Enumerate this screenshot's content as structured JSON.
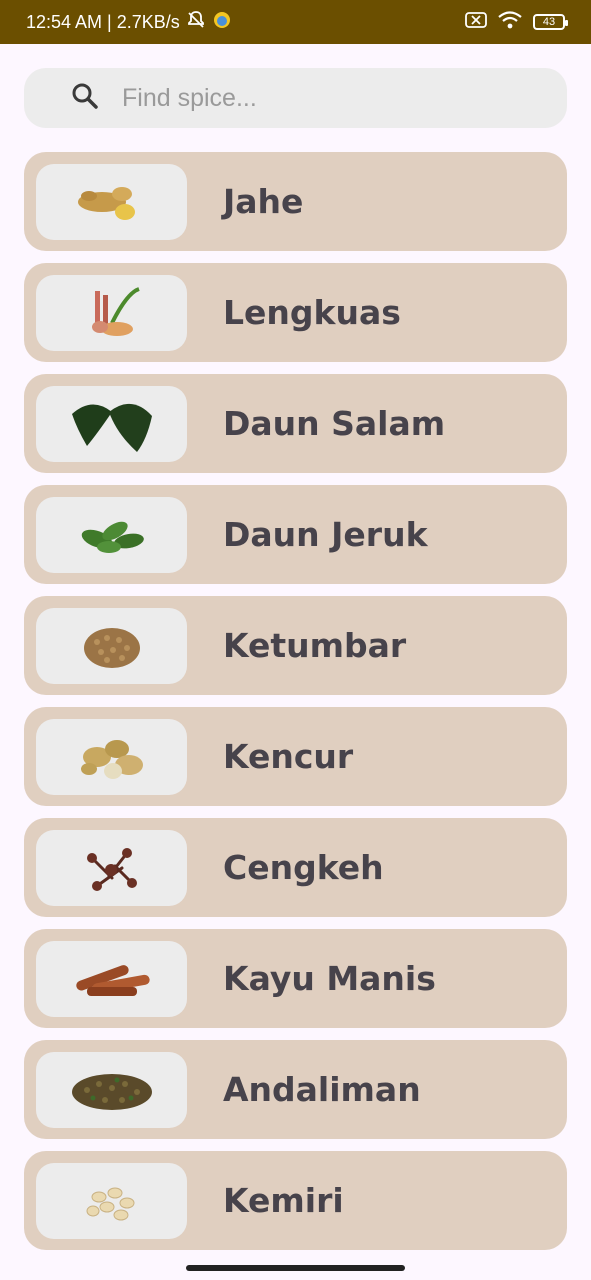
{
  "status_bar": {
    "time_speed": "12:54 AM | 2.7KB/s",
    "battery": "43",
    "icons": [
      "bell-off-icon",
      "app-notification-icon",
      "sim-off-icon",
      "wifi-icon",
      "battery-icon"
    ]
  },
  "search": {
    "placeholder": "Find spice...",
    "value": "",
    "icon": "search-icon"
  },
  "spices": [
    {
      "name": "Jahe",
      "icon": "ginger-image"
    },
    {
      "name": "Lengkuas",
      "icon": "galangal-image"
    },
    {
      "name": "Daun Salam",
      "icon": "bay-leaf-image"
    },
    {
      "name": "Daun Jeruk",
      "icon": "lime-leaf-image"
    },
    {
      "name": "Ketumbar",
      "icon": "coriander-seed-image"
    },
    {
      "name": "Kencur",
      "icon": "kencur-image"
    },
    {
      "name": "Cengkeh",
      "icon": "clove-image"
    },
    {
      "name": "Kayu Manis",
      "icon": "cinnamon-image"
    },
    {
      "name": "Andaliman",
      "icon": "andaliman-image"
    },
    {
      "name": "Kemiri",
      "icon": "candlenut-image"
    }
  ],
  "colors": {
    "status_bar": "#6b4f00",
    "background": "#fdf7ff",
    "card": "#e0cfc0",
    "thumb_bg": "#ececec",
    "text": "#47434b"
  }
}
